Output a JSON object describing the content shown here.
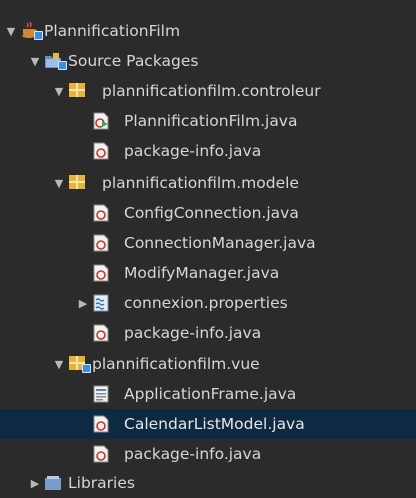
{
  "tree": {
    "project": {
      "label": "PlannificationFilm",
      "toggle": "▼",
      "icon": "java-project-icon"
    },
    "source_packages": {
      "label": "Source Packages",
      "toggle": "▼",
      "icon": "source-packages-icon"
    },
    "pkg_controleur": {
      "label": "plannificationfilm.controleur",
      "toggle": "▼",
      "icon": "package-icon",
      "files": [
        {
          "label": "PlannificationFilm.java",
          "icon": "java-main-class-icon"
        },
        {
          "label": "package-info.java",
          "icon": "java-file-icon"
        }
      ]
    },
    "pkg_modele": {
      "label": "plannificationfilm.modele",
      "toggle": "▼",
      "icon": "package-icon",
      "files": [
        {
          "label": "ConfigConnection.java",
          "icon": "java-file-icon"
        },
        {
          "label": "ConnectionManager.java",
          "icon": "java-file-icon"
        },
        {
          "label": "ModifyManager.java",
          "icon": "java-file-icon"
        },
        {
          "label": "connexion.properties",
          "icon": "properties-file-icon",
          "toggle": "▶"
        },
        {
          "label": "package-info.java",
          "icon": "java-file-icon"
        }
      ]
    },
    "pkg_vue": {
      "label": "plannificationfilm.vue",
      "toggle": "▼",
      "icon": "package-icon",
      "files": [
        {
          "label": "ApplicationFrame.java",
          "icon": "java-form-icon"
        },
        {
          "label": "CalendarListModel.java",
          "icon": "java-file-icon",
          "selected": true
        },
        {
          "label": "package-info.java",
          "icon": "java-file-icon"
        }
      ]
    },
    "libraries": {
      "label": "Libraries",
      "toggle": "▶",
      "icon": "libraries-icon"
    }
  },
  "colors": {
    "background": "#2b2b2b",
    "selection": "#0e2a43",
    "text": "#d6d6d6"
  }
}
